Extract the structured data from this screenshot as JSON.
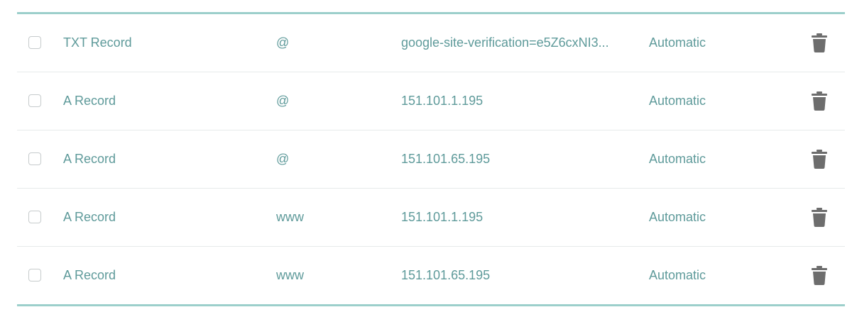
{
  "records": [
    {
      "type": "TXT Record",
      "host": "@",
      "value": "google-site-verification=e5Z6cxNI3...",
      "ttl": "Automatic"
    },
    {
      "type": "A Record",
      "host": "@",
      "value": "151.101.1.195",
      "ttl": "Automatic"
    },
    {
      "type": "A Record",
      "host": "@",
      "value": "151.101.65.195",
      "ttl": "Automatic"
    },
    {
      "type": "A Record",
      "host": "www",
      "value": "151.101.1.195",
      "ttl": "Automatic"
    },
    {
      "type": "A Record",
      "host": "www",
      "value": "151.101.65.195",
      "ttl": "Automatic"
    }
  ],
  "icons": {
    "delete": "trash-icon",
    "select": "checkbox"
  },
  "colors": {
    "accent_border": "#9ccfcb",
    "text": "#5e9a9a",
    "divider": "#e6eaea",
    "icon": "#6d6d6d"
  }
}
